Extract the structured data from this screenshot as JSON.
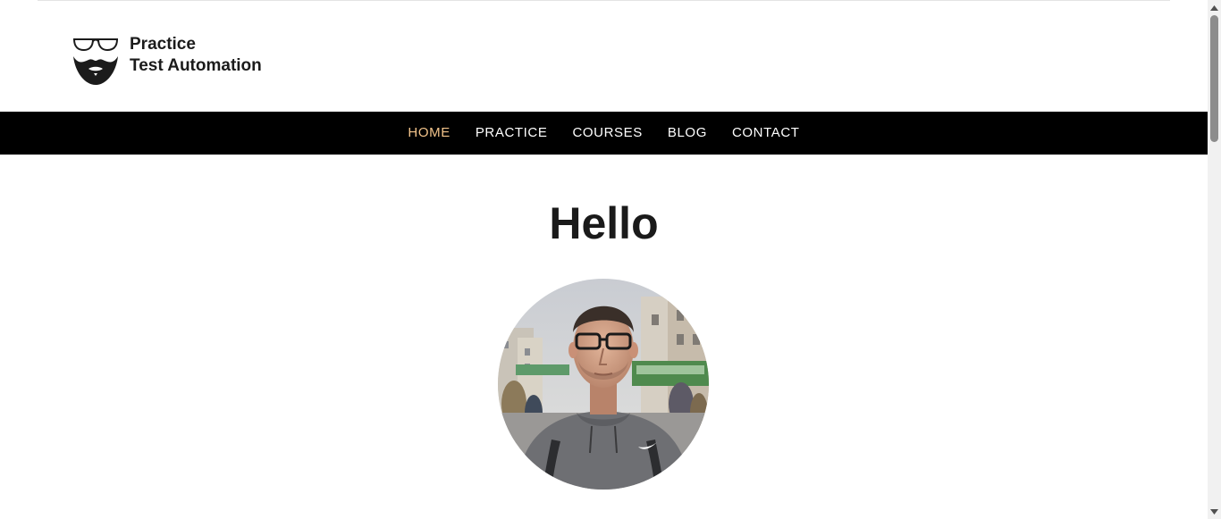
{
  "site": {
    "logo_line1": "Practice",
    "logo_line2": "Test Automation",
    "logo_icon": "glasses-beard-icon"
  },
  "nav": {
    "items": [
      {
        "label": "HOME",
        "active": true
      },
      {
        "label": "PRACTICE",
        "active": false
      },
      {
        "label": "COURSES",
        "active": false
      },
      {
        "label": "BLOG",
        "active": false
      },
      {
        "label": "CONTACT",
        "active": false
      }
    ],
    "active_color": "#f3c48b",
    "background_color": "#000000"
  },
  "hero": {
    "title": "Hello",
    "avatar_icon": "profile-photo"
  }
}
